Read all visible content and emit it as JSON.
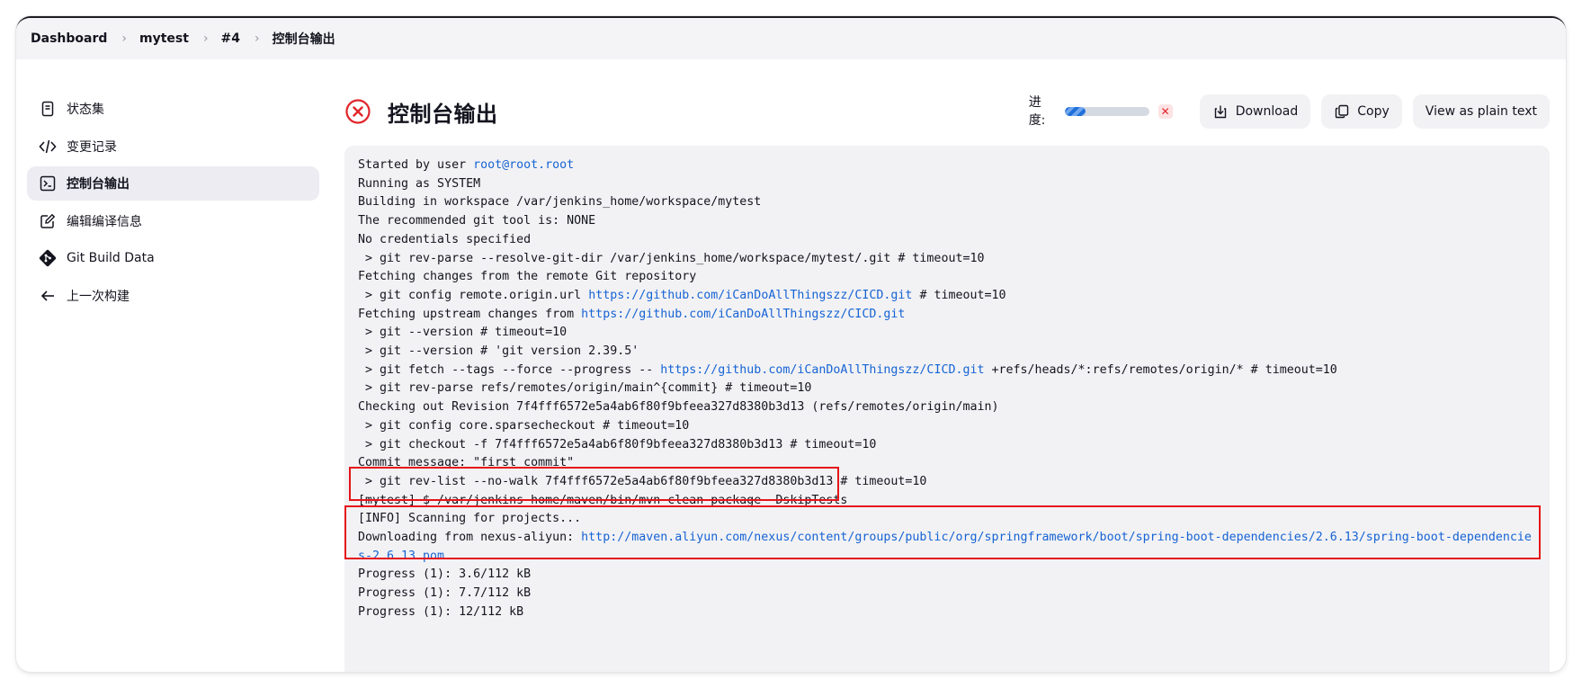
{
  "breadcrumb": [
    "Dashboard",
    "mytest",
    "#4",
    "控制台输出"
  ],
  "sidebar": {
    "items": [
      {
        "label": "状态集",
        "icon": "document-icon"
      },
      {
        "label": "变更记录",
        "icon": "code-icon"
      },
      {
        "label": "控制台输出",
        "icon": "terminal-icon",
        "active": true
      },
      {
        "label": "编辑编译信息",
        "icon": "edit-icon"
      },
      {
        "label": "Git Build Data",
        "icon": "git-icon"
      },
      {
        "label": "上一次构建",
        "icon": "arrow-left-icon"
      }
    ]
  },
  "header": {
    "title": "控制台输出",
    "status_icon": "failed-x-icon",
    "progress_label": "进度:",
    "progress_fraction": 0.25,
    "download_label": "Download",
    "copy_label": "Copy",
    "plain_text_label": "View as plain text"
  },
  "colors": {
    "link": "#1663d4",
    "status_failed": "#e0262c",
    "annotation": "#e5141b",
    "console_bg": "#f2f2f4"
  },
  "console": {
    "lines": [
      {
        "segments": [
          {
            "t": "Started by user "
          },
          {
            "t": "root@root.root",
            "link": true
          }
        ]
      },
      {
        "segments": [
          {
            "t": "Running as SYSTEM"
          }
        ]
      },
      {
        "segments": [
          {
            "t": "Building in workspace /var/jenkins_home/workspace/mytest"
          }
        ]
      },
      {
        "segments": [
          {
            "t": "The recommended git tool is: NONE"
          }
        ]
      },
      {
        "segments": [
          {
            "t": "No credentials specified"
          }
        ]
      },
      {
        "segments": [
          {
            "t": " > git rev-parse --resolve-git-dir /var/jenkins_home/workspace/mytest/.git # timeout=10"
          }
        ]
      },
      {
        "segments": [
          {
            "t": "Fetching changes from the remote Git repository"
          }
        ]
      },
      {
        "segments": [
          {
            "t": " > git config remote.origin.url "
          },
          {
            "t": "https://github.com/iCanDoAllThingszz/CICD.git",
            "link": true
          },
          {
            "t": " # timeout=10"
          }
        ]
      },
      {
        "segments": [
          {
            "t": "Fetching upstream changes from "
          },
          {
            "t": "https://github.com/iCanDoAllThingszz/CICD.git",
            "link": true
          }
        ]
      },
      {
        "segments": [
          {
            "t": " > git --version # timeout=10"
          }
        ]
      },
      {
        "segments": [
          {
            "t": " > git --version # 'git version 2.39.5'"
          }
        ]
      },
      {
        "segments": [
          {
            "t": " > git fetch --tags --force --progress -- "
          },
          {
            "t": "https://github.com/iCanDoAllThingszz/CICD.git",
            "link": true
          },
          {
            "t": " +refs/heads/*:refs/remotes/origin/* # timeout=10"
          }
        ]
      },
      {
        "segments": [
          {
            "t": " > git rev-parse refs/remotes/origin/main^{commit} # timeout=10"
          }
        ]
      },
      {
        "segments": [
          {
            "t": "Checking out Revision 7f4fff6572e5a4ab6f80f9bfeea327d8380b3d13 (refs/remotes/origin/main)"
          }
        ]
      },
      {
        "segments": [
          {
            "t": " > git config core.sparsecheckout # timeout=10"
          }
        ]
      },
      {
        "segments": [
          {
            "t": " > git checkout -f 7f4fff6572e5a4ab6f80f9bfeea327d8380b3d13 # timeout=10"
          }
        ]
      },
      {
        "segments": [
          {
            "t": "Commit message: \"first commit\""
          }
        ]
      },
      {
        "segments": [
          {
            "t": " > git rev-list --no-walk 7f4fff6572e5a4ab6f80f9bfeea327d8380b3d13 # timeout=10"
          }
        ]
      },
      {
        "segments": [
          {
            "t": "[mytest] $ /var/jenkins_home/maven/bin/mvn clean package -DskipTests"
          }
        ]
      },
      {
        "segments": [
          {
            "t": "[INFO] Scanning for projects..."
          }
        ]
      },
      {
        "wrap": true,
        "segments": [
          {
            "t": "Downloading from nexus-aliyun: "
          },
          {
            "t": "http://maven.aliyun.com/nexus/content/groups/public/org/springframework/boot/spring-boot-dependencies/2.6.13/spring-boot-dependencies-2.6.13.pom",
            "link": true
          }
        ]
      },
      {
        "segments": [
          {
            "t": "Progress (1): 3.6/112 kB"
          }
        ]
      },
      {
        "segments": [
          {
            "t": "Progress (1): 7.7/112 kB"
          }
        ]
      },
      {
        "segments": [
          {
            "t": "Progress (1): 12/112 kB"
          }
        ]
      }
    ]
  }
}
